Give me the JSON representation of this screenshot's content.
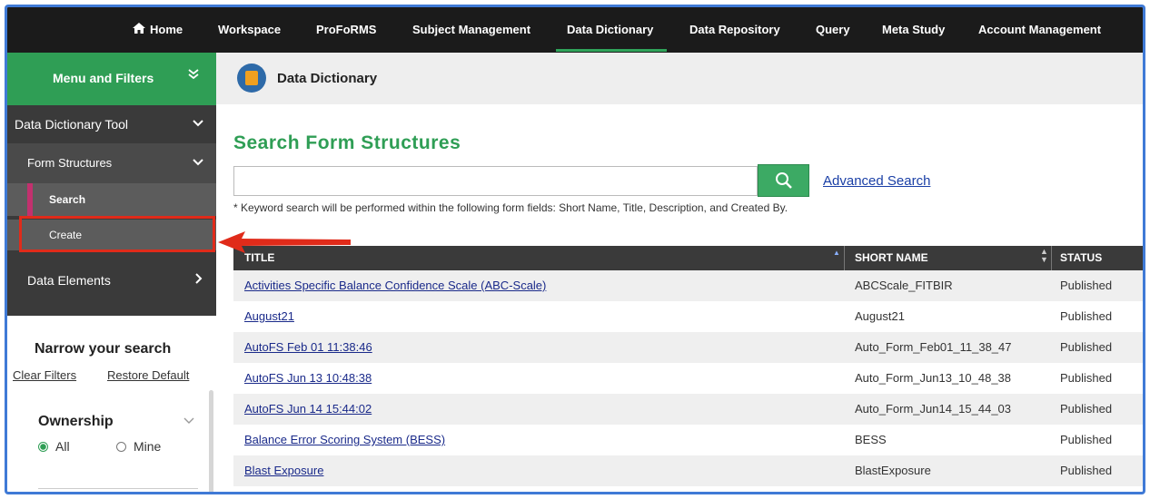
{
  "nav": {
    "home": "Home",
    "items": [
      "Workspace",
      "ProFoRMS",
      "Subject Management",
      "Data Dictionary",
      "Data Repository",
      "Query",
      "Meta Study",
      "Account Management"
    ],
    "active": "Data Dictionary"
  },
  "sidebar": {
    "menu_header": "Menu and Filters",
    "data_dictionary_tool": "Data Dictionary Tool",
    "form_structures": "Form Structures",
    "search": "Search",
    "create": "Create",
    "data_elements": "Data Elements"
  },
  "filters": {
    "narrow": "Narrow your search",
    "clear": "Clear Filters",
    "restore": "Restore Default",
    "ownership": "Ownership",
    "opt_all": "All",
    "opt_mine": "Mine",
    "selected": "All"
  },
  "page": {
    "title": "Data Dictionary",
    "heading": "Search Form Structures",
    "search_value": "",
    "advanced": "Advanced Search",
    "hint": "* Keyword search will be performed within the following form fields: Short Name, Title, Description, and Created By."
  },
  "table": {
    "headers": [
      "TITLE",
      "SHORT NAME",
      "STATUS"
    ],
    "rows": [
      {
        "title": "Activities Specific Balance Confidence Scale (ABC-Scale)",
        "short": "ABCScale_FITBIR",
        "status": "Published"
      },
      {
        "title": "August21",
        "short": "August21",
        "status": "Published"
      },
      {
        "title": "AutoFS Feb 01 11:38:46",
        "short": "Auto_Form_Feb01_11_38_47",
        "status": "Published"
      },
      {
        "title": "AutoFS Jun 13 10:48:38",
        "short": "Auto_Form_Jun13_10_48_38",
        "status": "Published"
      },
      {
        "title": "AutoFS Jun 14 15:44:02",
        "short": "Auto_Form_Jun14_15_44_03",
        "status": "Published"
      },
      {
        "title": "Balance Error Scoring System (BESS)",
        "short": "BESS",
        "status": "Published"
      },
      {
        "title": "Blast Exposure",
        "short": "BlastExposure",
        "status": "Published"
      }
    ]
  },
  "colors": {
    "accent_green": "#2f9e55",
    "highlight_red": "#e02b1a",
    "frame_blue": "#3f7ad6"
  }
}
